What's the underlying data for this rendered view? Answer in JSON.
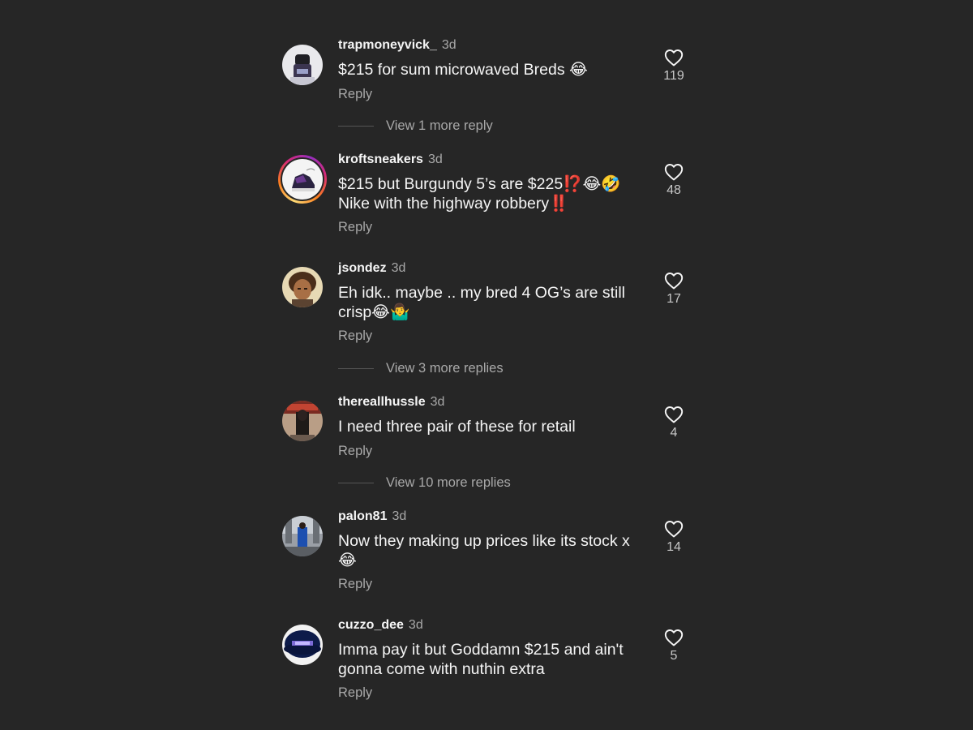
{
  "comments": [
    {
      "username": "trapmoneyvick_",
      "time": "3d",
      "text": "$215 for sum microwaved Breds 😂",
      "reply_label": "Reply",
      "likes": "119",
      "view_more": "View 1 more reply"
    },
    {
      "username": "kroftsneakers",
      "time": "3d",
      "text": "$215 but Burgundy 5’s are $225⁉️😂🤣\nNike with the highway robbery‼️",
      "reply_label": "Reply",
      "likes": "48"
    },
    {
      "username": "jsondez",
      "time": "3d",
      "text": "Eh idk.. maybe .. my bred 4 OG’s are still\ncrisp😂🤷‍♂️",
      "reply_label": "Reply",
      "likes": "17",
      "view_more": "View 3 more replies"
    },
    {
      "username": "thereallhussle",
      "time": "3d",
      "text": "I need three pair of these for retail",
      "reply_label": "Reply",
      "likes": "4",
      "view_more": "View 10 more replies"
    },
    {
      "username": "palon81",
      "time": "3d",
      "text": "Now they making up prices like its stock x\n😂",
      "reply_label": "Reply",
      "likes": "14"
    },
    {
      "username": "cuzzo_dee",
      "time": "3d",
      "text": "Imma pay it but Goddamn $215 and ain't\ngonna come with nuthin extra",
      "reply_label": "Reply",
      "likes": "5"
    }
  ]
}
